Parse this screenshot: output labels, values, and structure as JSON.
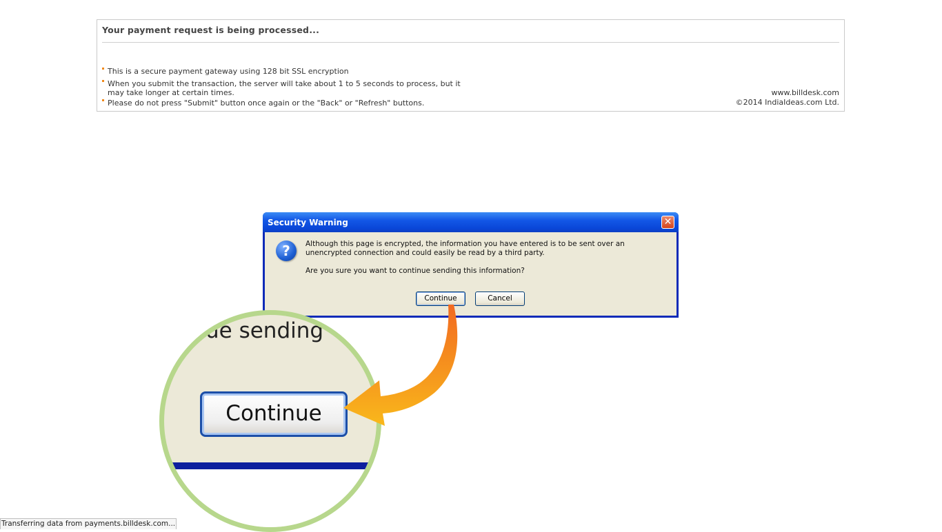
{
  "payment": {
    "title": "Your payment request is being processed...",
    "notes": [
      "This is a secure payment gateway using 128 bit SSL encryption",
      "When you submit the transaction, the server will take about 1 to 5 seconds to process, but it",
      "may take longer at certain times.",
      "Please do not press \"Submit\" button once again or the \"Back\" or \"Refresh\" buttons."
    ],
    "site": "www.billdesk.com",
    "copyright": "©2014 IndiaIdeas.com Ltd."
  },
  "dialog": {
    "title": "Security Warning",
    "close_glyph": "✕",
    "icon": "question-icon",
    "message_line1": "Although this page is encrypted, the information you have entered is to be sent over an",
    "message_line2": "unencrypted connection and could easily be read by a third party.",
    "question": "Are you sure you want to continue sending this information?",
    "continue_label": "Continue",
    "cancel_label": "Cancel"
  },
  "magnifier": {
    "partial_text": "ue sending",
    "button_label": "Continue"
  },
  "status_bar": {
    "text": "Transferring data from payments.billdesk.com..."
  },
  "colors": {
    "bullet": "#f08a1c",
    "magnifier_ring": "#b7d78c",
    "arrow_start": "#f26a21",
    "arrow_end": "#f9b81b"
  }
}
